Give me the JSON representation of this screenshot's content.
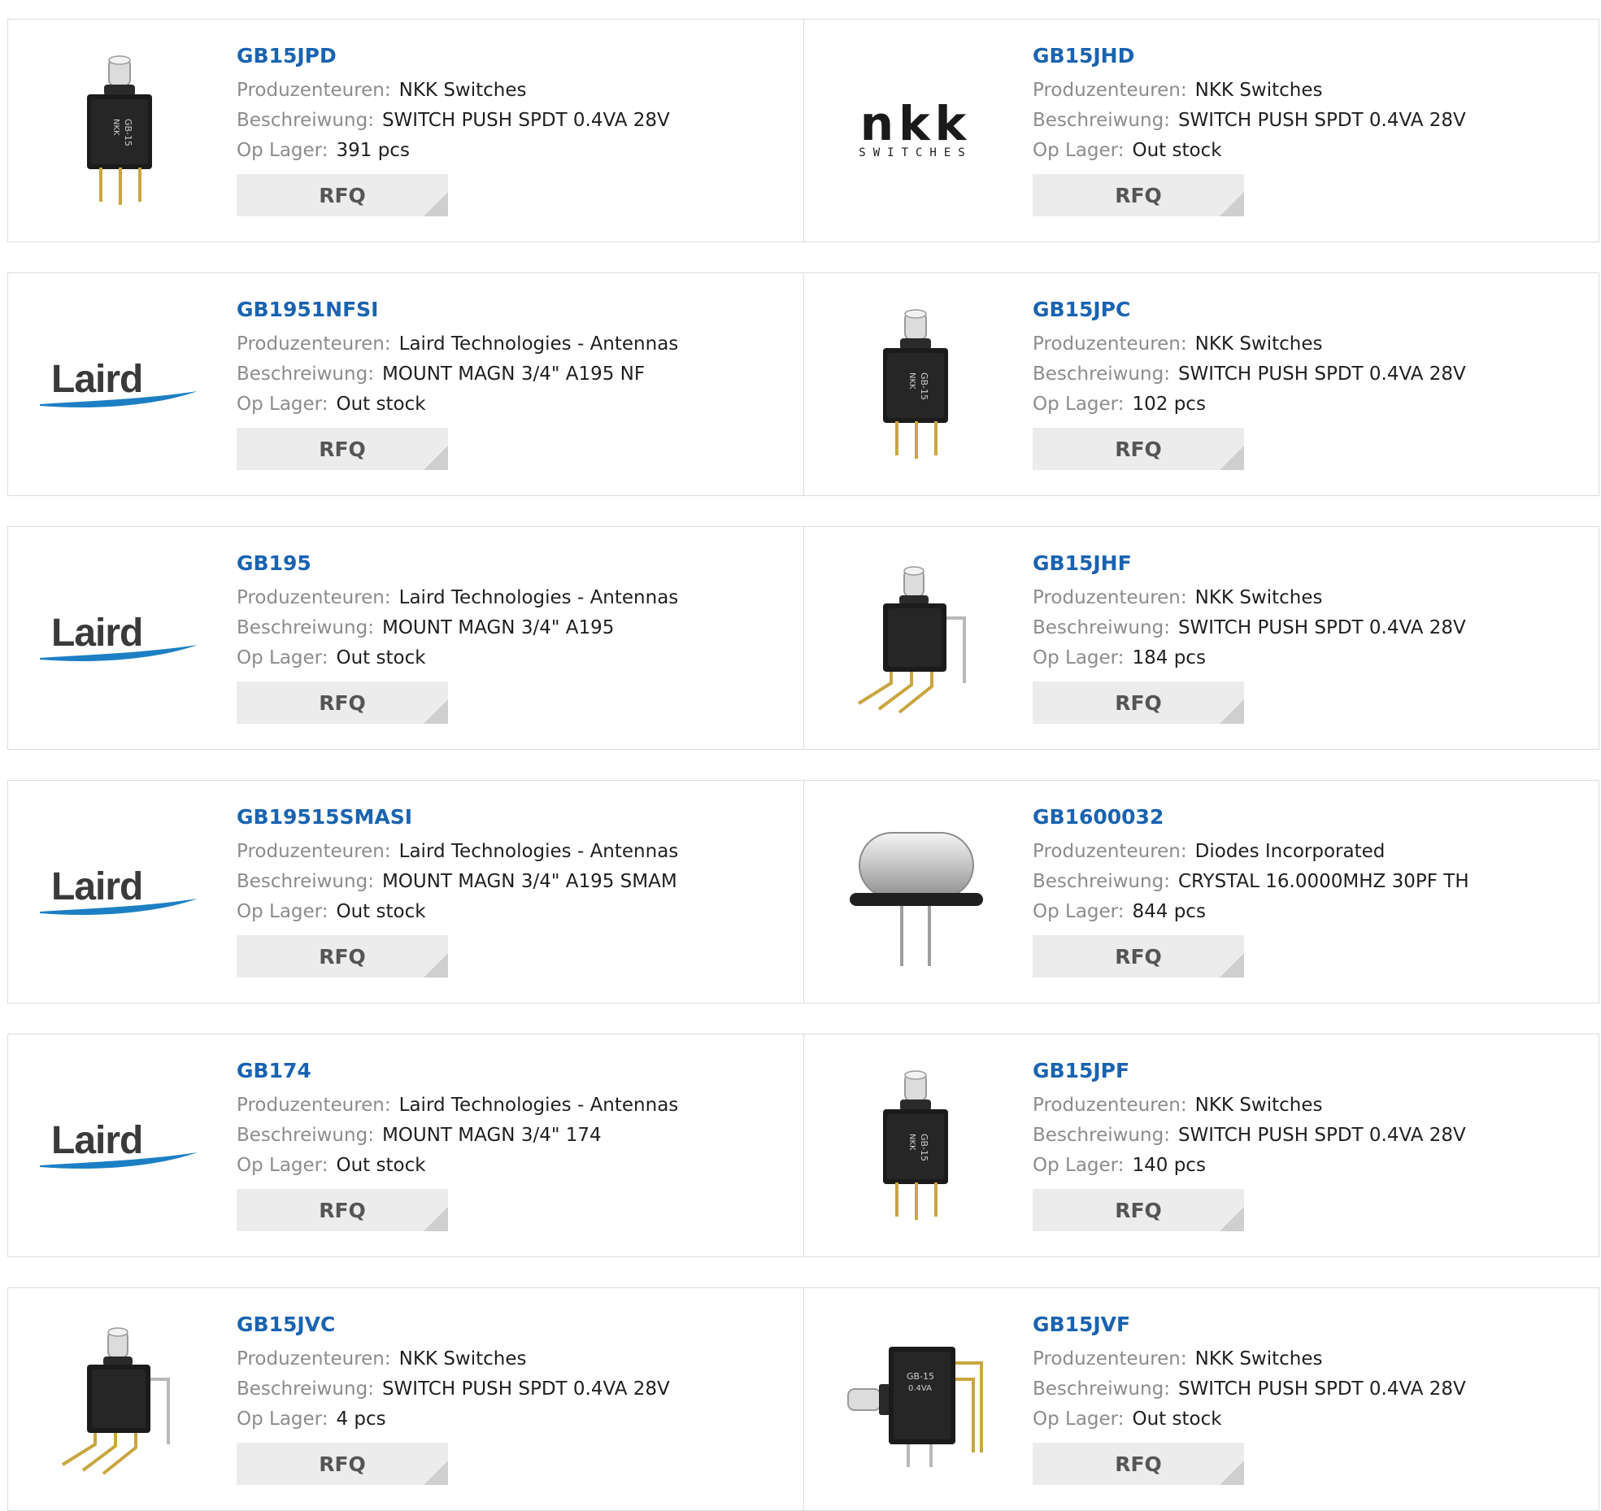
{
  "products": [
    {
      "part": "GB15JPD",
      "manufacturer_label": "Produzenteuren:",
      "manufacturer": "NKK Switches",
      "description_label": "Beschreiwung:",
      "description": "SWITCH PUSH SPDT 0.4VA 28V",
      "stock_label": "Op Lager:",
      "stock": "391 pcs",
      "rfq": "RFQ",
      "image": "pushbutton-switch-icon"
    },
    {
      "part": "GB15JHD",
      "manufacturer_label": "Produzenteuren:",
      "manufacturer": "NKK Switches",
      "description_label": "Beschreiwung:",
      "description": "SWITCH PUSH SPDT 0.4VA 28V",
      "stock_label": "Op Lager:",
      "stock": "Out stock",
      "rfq": "RFQ",
      "image": "nkk-logo",
      "logo_text": "nkk",
      "logo_subtext": "SWITCHES"
    },
    {
      "part": "GB1951NFSI",
      "manufacturer_label": "Produzenteuren:",
      "manufacturer": "Laird Technologies - Antennas",
      "description_label": "Beschreiwung:",
      "description": "MOUNT MAGN 3/4\" A195 NF",
      "stock_label": "Op Lager:",
      "stock": "Out stock",
      "rfq": "RFQ",
      "image": "laird-logo",
      "logo_text": "Laird"
    },
    {
      "part": "GB15JPC",
      "manufacturer_label": "Produzenteuren:",
      "manufacturer": "NKK Switches",
      "description_label": "Beschreiwung:",
      "description": "SWITCH PUSH SPDT 0.4VA 28V",
      "stock_label": "Op Lager:",
      "stock": "102 pcs",
      "rfq": "RFQ",
      "image": "pushbutton-switch-icon"
    },
    {
      "part": "GB195",
      "manufacturer_label": "Produzenteuren:",
      "manufacturer": "Laird Technologies - Antennas",
      "description_label": "Beschreiwung:",
      "description": "MOUNT MAGN 3/4\" A195",
      "stock_label": "Op Lager:",
      "stock": "Out stock",
      "rfq": "RFQ",
      "image": "laird-logo",
      "logo_text": "Laird"
    },
    {
      "part": "GB15JHF",
      "manufacturer_label": "Produzenteuren:",
      "manufacturer": "NKK Switches",
      "description_label": "Beschreiwung:",
      "description": "SWITCH PUSH SPDT 0.4VA 28V",
      "stock_label": "Op Lager:",
      "stock": "184 pcs",
      "rfq": "RFQ",
      "image": "right-angle-switch-icon"
    },
    {
      "part": "GB19515SMASI",
      "manufacturer_label": "Produzenteuren:",
      "manufacturer": "Laird Technologies - Antennas",
      "description_label": "Beschreiwung:",
      "description": "MOUNT MAGN 3/4\" A195 SMAM",
      "stock_label": "Op Lager:",
      "stock": "Out stock",
      "rfq": "RFQ",
      "image": "laird-logo",
      "logo_text": "Laird"
    },
    {
      "part": "GB1600032",
      "manufacturer_label": "Produzenteuren:",
      "manufacturer": "Diodes Incorporated",
      "description_label": "Beschreiwung:",
      "description": "CRYSTAL 16.0000MHZ 30PF TH",
      "stock_label": "Op Lager:",
      "stock": "844 pcs",
      "rfq": "RFQ",
      "image": "crystal-oscillator-icon"
    },
    {
      "part": "GB174",
      "manufacturer_label": "Produzenteuren:",
      "manufacturer": "Laird Technologies - Antennas",
      "description_label": "Beschreiwung:",
      "description": "MOUNT MAGN 3/4\" 174",
      "stock_label": "Op Lager:",
      "stock": "Out stock",
      "rfq": "RFQ",
      "image": "laird-logo",
      "logo_text": "Laird"
    },
    {
      "part": "GB15JPF",
      "manufacturer_label": "Produzenteuren:",
      "manufacturer": "NKK Switches",
      "description_label": "Beschreiwung:",
      "description": "SWITCH PUSH SPDT 0.4VA 28V",
      "stock_label": "Op Lager:",
      "stock": "140 pcs",
      "rfq": "RFQ",
      "image": "pushbutton-switch-icon"
    },
    {
      "part": "GB15JVC",
      "manufacturer_label": "Produzenteuren:",
      "manufacturer": "NKK Switches",
      "description_label": "Beschreiwung:",
      "description": "SWITCH PUSH SPDT 0.4VA 28V",
      "stock_label": "Op Lager:",
      "stock": "4 pcs",
      "rfq": "RFQ",
      "image": "right-angle-switch-icon"
    },
    {
      "part": "GB15JVF",
      "manufacturer_label": "Produzenteuren:",
      "manufacturer": "NKK Switches",
      "description_label": "Beschreiwung:",
      "description": "SWITCH PUSH SPDT 0.4VA 28V",
      "stock_label": "Op Lager:",
      "stock": "Out stock",
      "rfq": "RFQ",
      "image": "horizontal-switch-icon"
    }
  ],
  "colors": {
    "link": "#1a63b0",
    "label": "#8c8c8c",
    "value": "#1f1f1f",
    "border": "#dcdcdc",
    "button_bg": "#ececec",
    "laird_blue": "#1c7fc4",
    "nkk_red": "#e2231a"
  }
}
